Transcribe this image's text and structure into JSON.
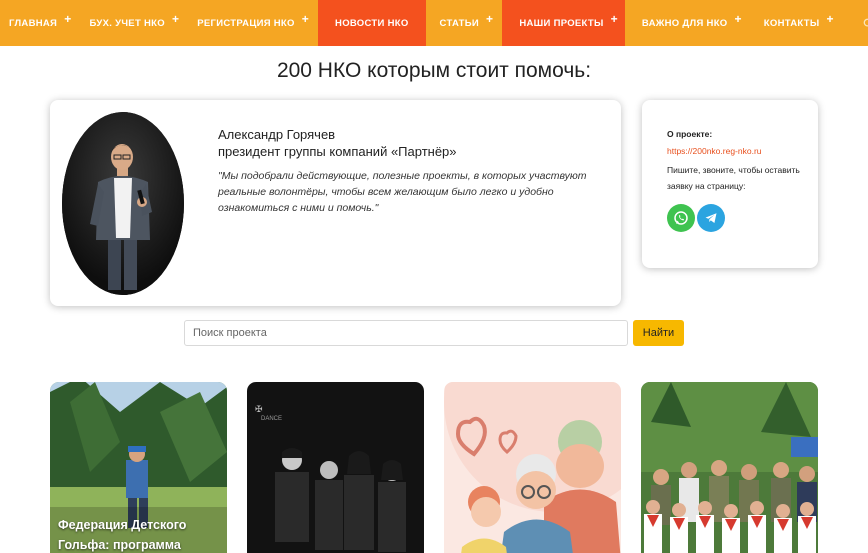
{
  "nav": {
    "items": [
      {
        "label": "ГЛАВНАЯ",
        "has_submenu": true,
        "active": false
      },
      {
        "label": "БУХ. УЧЕТ НКО",
        "has_submenu": true,
        "active": false
      },
      {
        "label": "РЕГИСТРАЦИЯ НКО",
        "has_submenu": true,
        "active": false
      },
      {
        "label": "НОВОСТИ НКО",
        "has_submenu": false,
        "active": true
      },
      {
        "label": "СТАТЬИ",
        "has_submenu": true,
        "active": false
      },
      {
        "label": "НАШИ ПРОЕКТЫ",
        "has_submenu": true,
        "active": true
      },
      {
        "label": "ВАЖНО ДЛЯ НКО",
        "has_submenu": true,
        "active": false
      },
      {
        "label": "КОНТАКТЫ",
        "has_submenu": true,
        "active": false
      }
    ],
    "submenu_marker": "+",
    "search_icon": "search-icon",
    "colors": {
      "bar": "#f5a623",
      "active": "#f4511e"
    }
  },
  "page": {
    "title": "200 НКО которым стоит помочь:"
  },
  "intro": {
    "name": "Александр Горячев",
    "role": "президент группы компаний «Партнёр»",
    "quote": "\"Мы подобрали действующие, полезные проекты, в которых участвуют реальные волонтёры, чтобы всем желающим было легко и удобно ознакомиться с ними и помочь.\""
  },
  "about": {
    "label": "О проекте:",
    "link": "https://200nko.reg-nko.ru",
    "text": "Пишите, звоните, чтобы оставить заявку на страницу:",
    "icons": [
      "whatsapp-icon",
      "telegram-icon"
    ]
  },
  "search": {
    "placeholder": "Поиск проекта",
    "value": "",
    "button_label": "Найти"
  },
  "projects": [
    {
      "title": "Федерация Детского Гольфа: программа"
    },
    {
      "title": ""
    },
    {
      "title": ""
    },
    {
      "title": ""
    }
  ]
}
